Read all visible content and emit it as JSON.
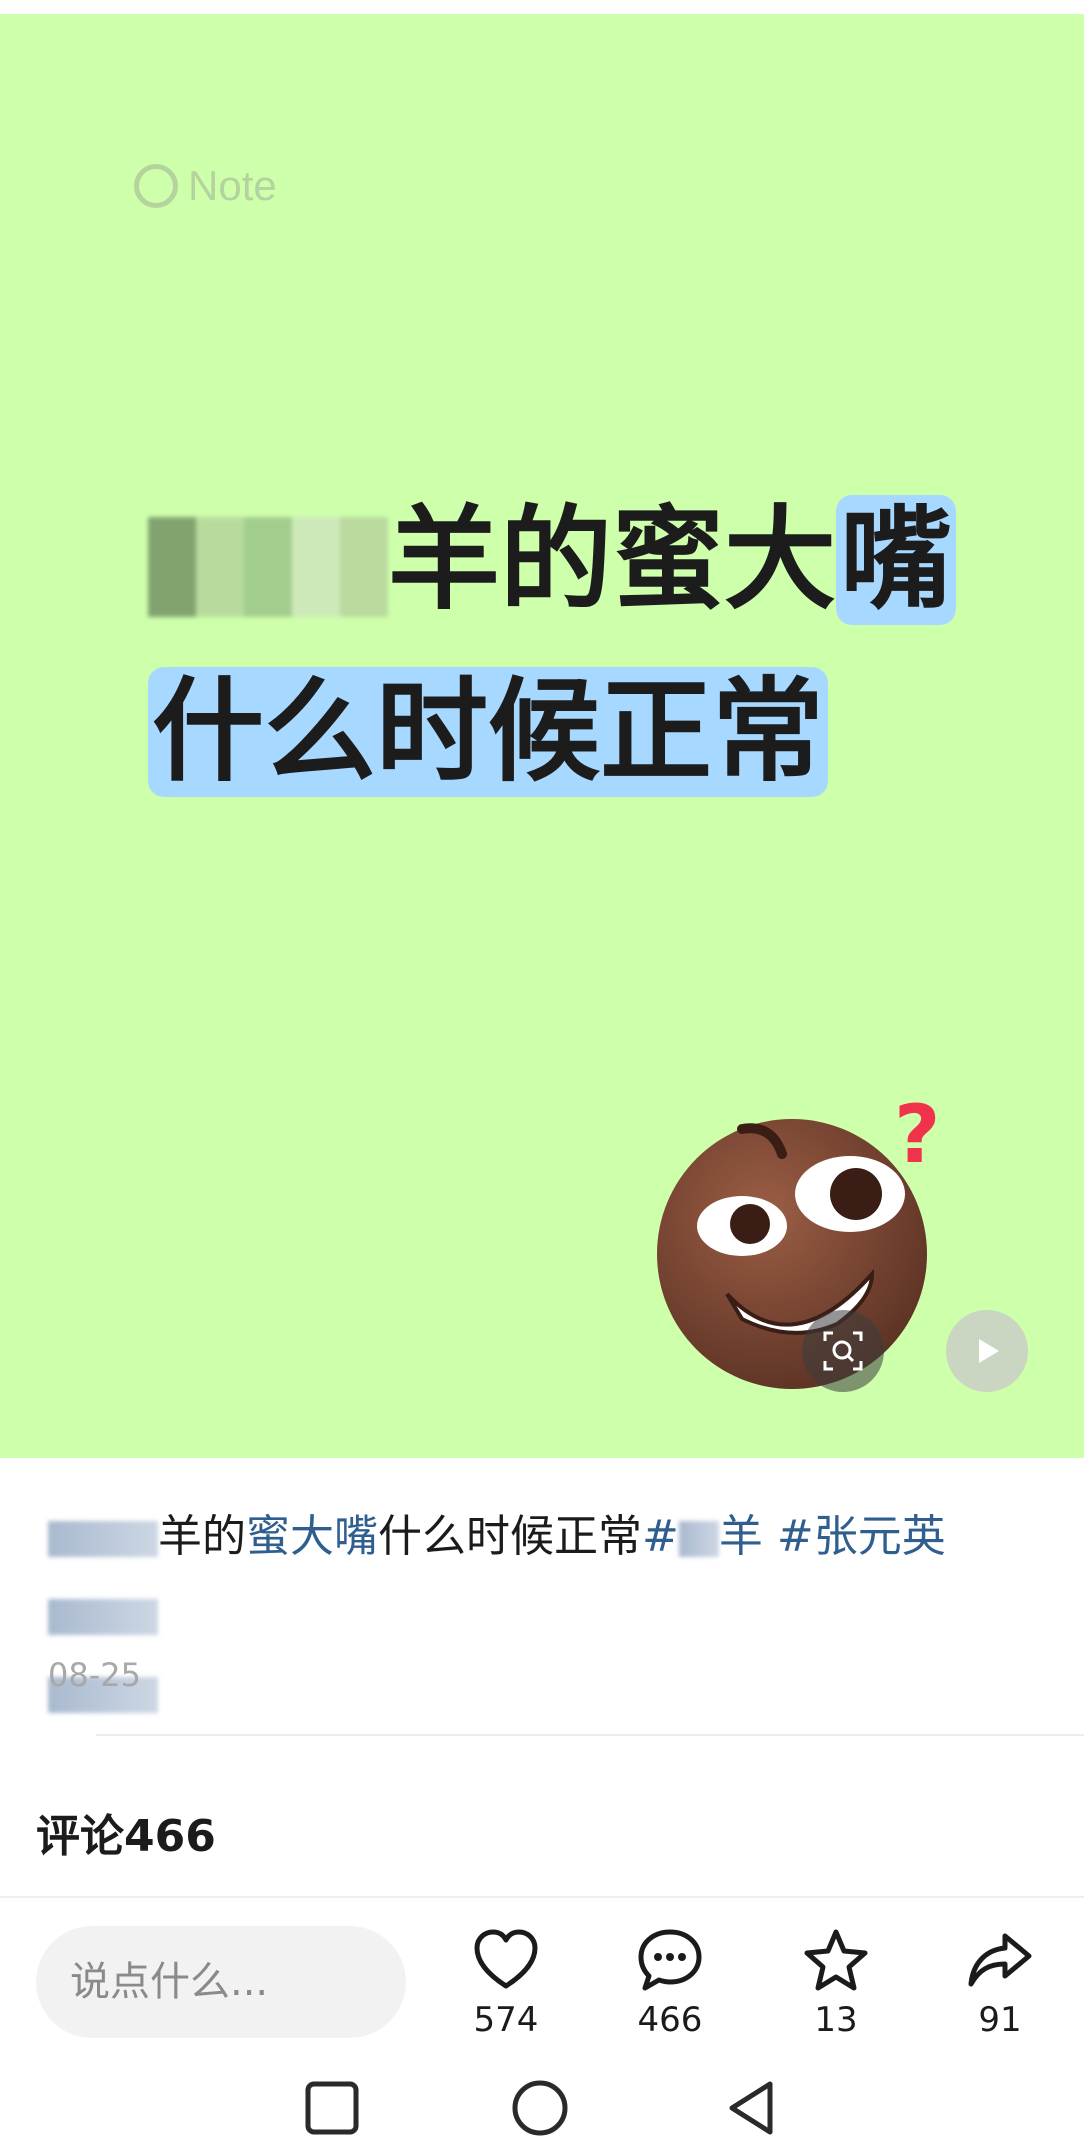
{
  "post": {
    "note_label": "Note",
    "headline_line1_tail": "羊的蜜大",
    "headline_line1_hl": "嘴",
    "headline_line2": "什么时候正常",
    "caption_prefix": "羊的",
    "caption_link": "蜜大嘴",
    "caption_middle": "什么时候正常",
    "caption_tag1": "#",
    "caption_tag1_tail": "羊",
    "caption_tag2": "#张元英",
    "date": "08-25"
  },
  "comments": {
    "title": "评论466"
  },
  "bottom_bar": {
    "input_placeholder": "说点什么...",
    "likes": "574",
    "comments": "466",
    "favorites": "13",
    "shares": "91"
  },
  "colors": {
    "hero_bg": "#ceffab",
    "highlight": "#a7d8ff",
    "link": "#2f5e8f"
  },
  "icons": [
    "note-circle-icon",
    "image-search-icon",
    "play-icon",
    "heart-icon",
    "comment-bubble-icon",
    "star-icon",
    "share-arrow-icon",
    "recent-apps-icon",
    "home-icon",
    "back-icon"
  ]
}
